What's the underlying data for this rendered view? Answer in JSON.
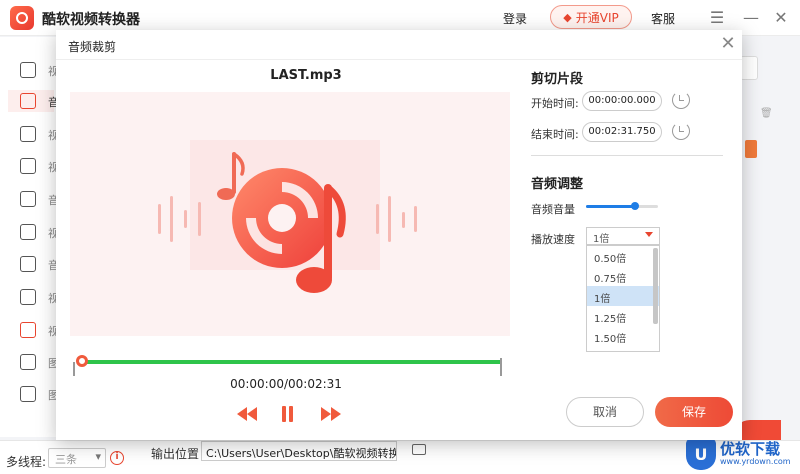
{
  "app": {
    "title": "酷软视频转换器",
    "login_label": "登录",
    "vip_label": "开通VIP",
    "service_label": "客服"
  },
  "sidebar": {
    "items": [
      {
        "label": "视",
        "icon": "video-convert-icon"
      },
      {
        "label": "音",
        "icon": "audio-icon"
      },
      {
        "label": "视",
        "icon": "video-edit-icon"
      },
      {
        "label": "视",
        "icon": "video-play-icon"
      },
      {
        "label": "音",
        "icon": "speaker-icon"
      },
      {
        "label": "视",
        "icon": "split-icon"
      },
      {
        "label": "音",
        "icon": "audio-split-icon"
      },
      {
        "label": "视",
        "icon": "crop-icon"
      },
      {
        "label": "视",
        "icon": "gif-icon"
      },
      {
        "label": "图",
        "icon": "image-icon"
      },
      {
        "label": "图",
        "icon": "image-split-icon"
      }
    ]
  },
  "bottom_bar": {
    "threads_label": "多线程:",
    "threads_value": "三条",
    "output_label": "输出位置",
    "output_path": "C:\\Users\\User\\Desktop\\酷软视频转换器"
  },
  "watermark": {
    "title": "优软下载",
    "url": "www.yrdown.com"
  },
  "dialog": {
    "title": "音频裁剪",
    "file_name": "LAST.mp3",
    "time_readout": "00:00:00/00:02:31",
    "clip_section_title": "剪切片段",
    "start_label": "开始时间:",
    "start_value": "00:00:00.000",
    "end_label": "结束时间:",
    "end_value": "00:02:31.750",
    "audio_section_title": "音频调整",
    "volume_label": "音频音量",
    "volume_level": 0.68,
    "speed_label": "播放速度",
    "speed_value": "1倍",
    "speed_options": [
      "0.50倍",
      "0.75倍",
      "1倍",
      "1.25倍",
      "1.50倍"
    ],
    "speed_selected_index": 2,
    "cancel_label": "取消",
    "save_label": "保存"
  },
  "colors": {
    "accent": "#f05a3c",
    "timeline_green": "#2ec44a",
    "slider_blue": "#1e7de6"
  }
}
